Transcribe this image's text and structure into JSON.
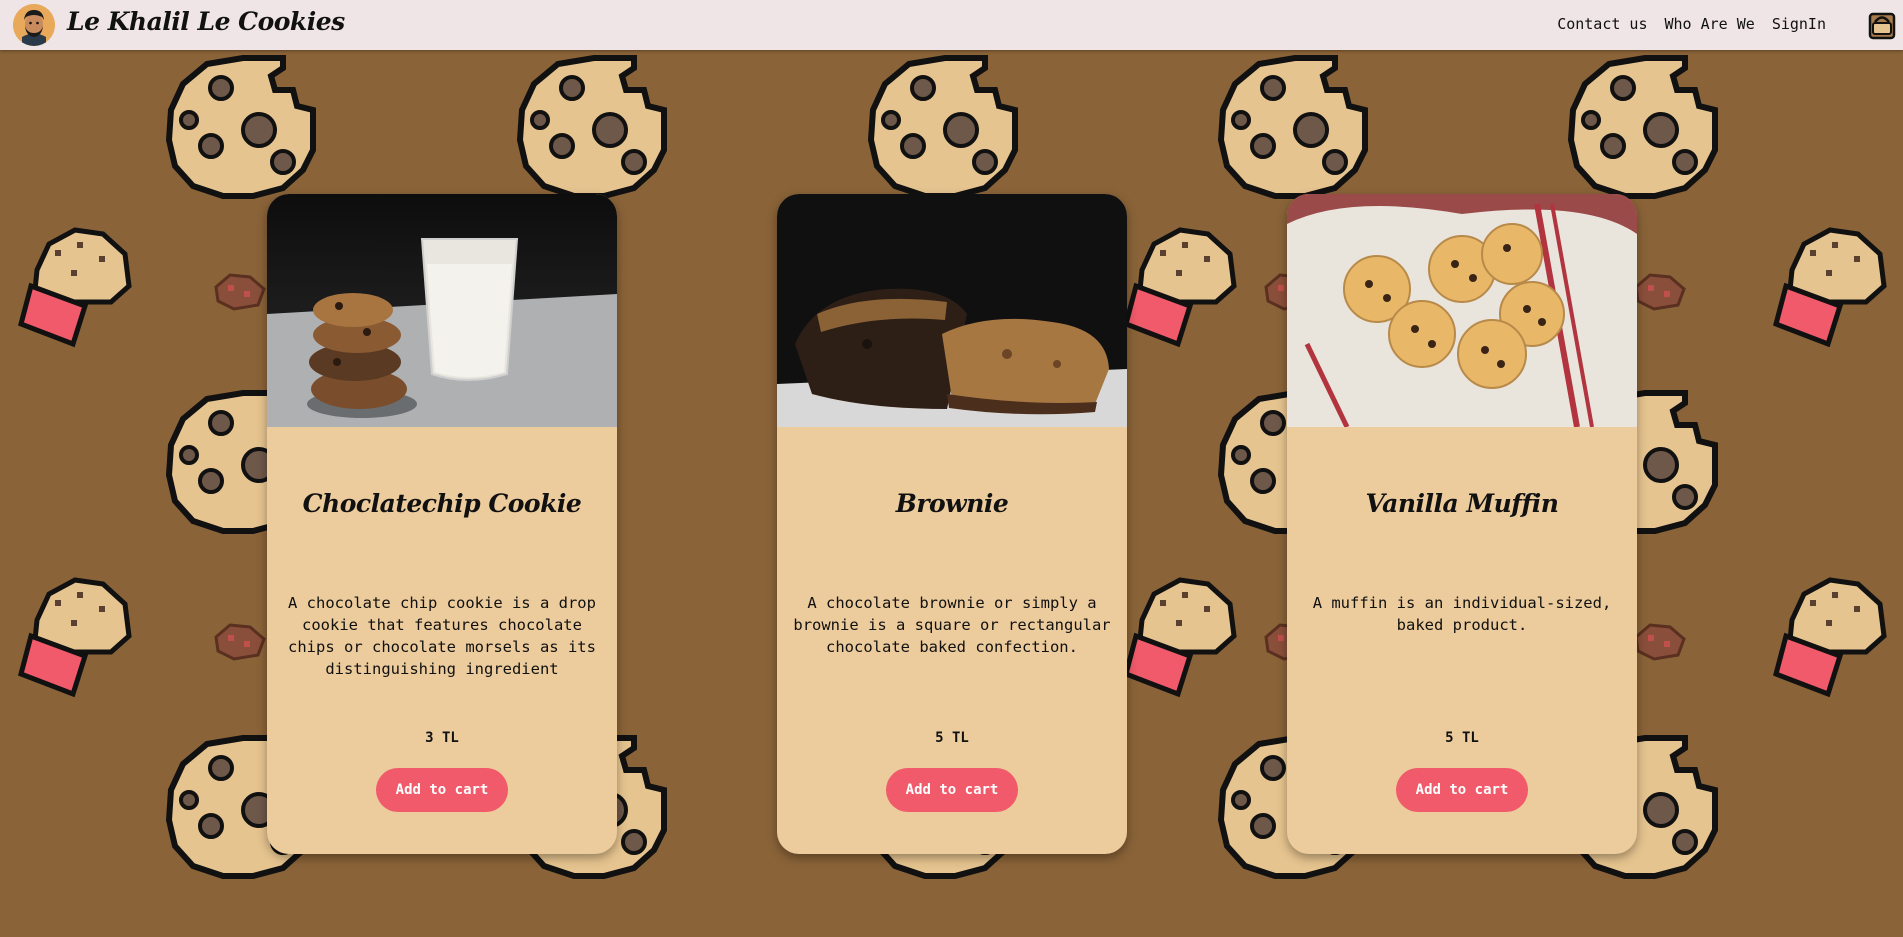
{
  "header": {
    "brand": "Le Khalil Le Cookies",
    "nav": [
      "Contact us",
      "Who Are We",
      "SignIn"
    ]
  },
  "products": [
    {
      "name": "Choclatechip Cookie",
      "description": "A chocolate chip cookie is a drop cookie that features chocolate chips or chocolate morsels as its distinguishing ingredient",
      "price": "3 TL",
      "button": "Add to cart"
    },
    {
      "name": "Brownie",
      "description": "A chocolate brownie or simply a brownie is a square or rectangular chocolate baked confection.",
      "price": "5 TL",
      "button": "Add to cart"
    },
    {
      "name": "Vanilla Muffin",
      "description": "A muffin is an individual-sized, baked product.",
      "price": "5 TL",
      "button": "Add to cart"
    }
  ],
  "colors": {
    "background": "#8a6338",
    "header": "#efe5e6",
    "card": "#eccb9c",
    "button": "#f05a6a"
  }
}
